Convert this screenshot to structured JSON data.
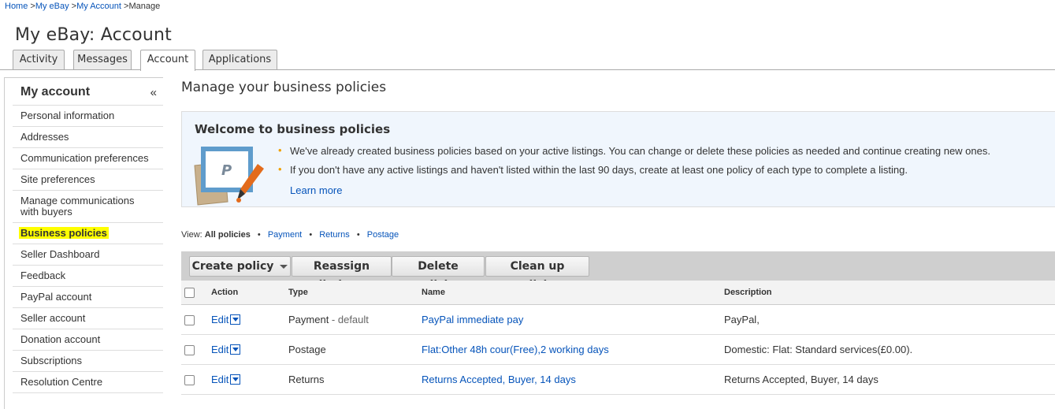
{
  "breadcrumb": {
    "home": "Home",
    "sep1": " >",
    "my_ebay": "My eBay",
    "sep2": " >",
    "my_account": "My Account",
    "sep3": " >",
    "current": "Manage"
  },
  "page_title": "My eBay: Account",
  "tabs": [
    {
      "label": "Activity"
    },
    {
      "label": "Messages"
    },
    {
      "label": "Account"
    },
    {
      "label": "Applications"
    }
  ],
  "sidebar": {
    "title": "My account",
    "collapse": "«",
    "items": [
      {
        "label": "Personal information"
      },
      {
        "label": "Addresses"
      },
      {
        "label": "Communication preferences"
      },
      {
        "label": "Site preferences"
      },
      {
        "label": "Manage communications with buyers"
      },
      {
        "label": "Business policies"
      },
      {
        "label": "Seller Dashboard"
      },
      {
        "label": "Feedback"
      },
      {
        "label": "PayPal account"
      },
      {
        "label": "Seller account"
      },
      {
        "label": "Donation account"
      },
      {
        "label": "Subscriptions"
      },
      {
        "label": "Resolution Centre"
      }
    ]
  },
  "main": {
    "title": "Manage your business policies",
    "welcome": {
      "title": "Welcome to business policies",
      "bullets": [
        "We've already created business policies based on your active listings. You can change or delete these policies as needed and continue creating new ones.",
        "If you don't have any active listings and haven't listed within the last 90 days, create at least one policy of each type to complete a listing."
      ],
      "learn_more": "Learn more"
    },
    "view": {
      "label": "View:",
      "all": "All policies",
      "dot": "•",
      "payment": "Payment",
      "returns": "Returns",
      "postage": "Postage"
    },
    "toolbar": {
      "create": "Create policy",
      "reassign": "Reassign listings",
      "delete": "Delete policies",
      "cleanup": "Clean up policies"
    },
    "table": {
      "headers": {
        "action": "Action",
        "type": "Type",
        "name": "Name",
        "description": "Description"
      },
      "rows": [
        {
          "action": "Edit",
          "type": "Payment",
          "type_suffix": " - default",
          "name": "PayPal immediate pay",
          "description": "PayPal,"
        },
        {
          "action": "Edit",
          "type": "Postage",
          "type_suffix": "",
          "name": "Flat:Other 48h cour(Free),2 working days",
          "description": "Domestic: Flat: Standard services(£0.00)."
        },
        {
          "action": "Edit",
          "type": "Returns",
          "type_suffix": "",
          "name": "Returns Accepted, Buyer, 14 days",
          "description": "Returns Accepted, Buyer, 14 days"
        }
      ]
    }
  },
  "colors": {
    "link": "#0654ba",
    "highlight": "#ffff00",
    "bullet": "#f0a000",
    "toolbar_bg": "#cfcfcf"
  }
}
